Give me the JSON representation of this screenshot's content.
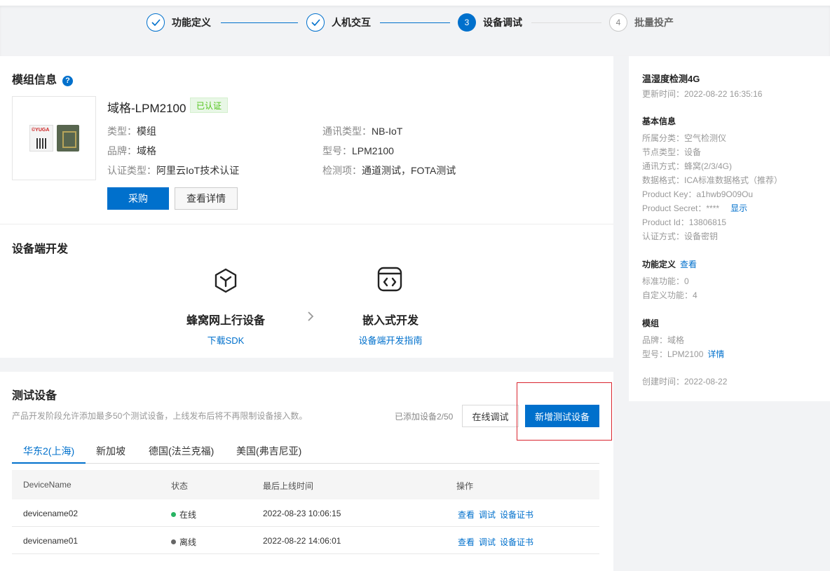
{
  "stepper": {
    "steps": [
      {
        "label": "功能定义",
        "state": "done",
        "icon": "check-icon"
      },
      {
        "label": "人机交互",
        "state": "done",
        "icon": "check-icon"
      },
      {
        "label": "设备调试",
        "state": "active",
        "number": "3"
      },
      {
        "label": "批量投产",
        "state": "todo",
        "number": "4"
      }
    ]
  },
  "module": {
    "title": "模组信息",
    "help_icon": "?",
    "name": "域格-LPM2100",
    "badge": "已认证",
    "image_logo_text": "©YUGA",
    "type_label": "类型：",
    "type_value": "模组",
    "brand_label": "品牌：",
    "brand_value": "域格",
    "cert_label": "认证类型：",
    "cert_value": "阿里云IoT技术认证",
    "comm_label": "通讯类型：",
    "comm_value": "NB-IoT",
    "model_label": "型号：",
    "model_value": "LPM2100",
    "check_label": "检测项：",
    "check_value": "通道测试，FOTA测试",
    "buy_button": "采购",
    "detail_button": "查看详情"
  },
  "device_dev": {
    "title": "设备端开发",
    "cards": [
      {
        "title": "蜂窝网上行设备",
        "link": "下载SDK",
        "icon": "cube-icon"
      },
      {
        "title": "嵌入式开发",
        "link": "设备端开发指南",
        "icon": "code-window-icon"
      }
    ],
    "arrow": "›"
  },
  "test_devices": {
    "title": "测试设备",
    "desc": "产品开发阶段允许添加最多50个测试设备，上线发布后将不再限制设备接入数。",
    "count_text": "已添加设备2/50",
    "online_debug_button": "在线调试",
    "add_button": "新增测试设备",
    "highlight_color": "#d9252f",
    "tabs": [
      "华东2(上海)",
      "新加坡",
      "德国(法兰克福)",
      "美国(弗吉尼亚)"
    ],
    "active_tab": 0,
    "columns": [
      "DeviceName",
      "状态",
      "最后上线时间",
      "操作"
    ],
    "rows": [
      {
        "name": "devicename02",
        "status": "在线",
        "status_color": "#28b463",
        "time": "2022-08-23 10:06:15",
        "ops": [
          "查看",
          "调试",
          "设备证书"
        ]
      },
      {
        "name": "devicename01",
        "status": "离线",
        "status_color": "#666666",
        "time": "2022-08-22 14:06:01",
        "ops": [
          "查看",
          "调试",
          "设备证书"
        ]
      }
    ]
  },
  "sidebar": {
    "product_name": "温湿度检测4G",
    "update_time": "更新时间：2022-08-22 16:35:16",
    "basic_title": "基本信息",
    "basic_lines": [
      "所属分类：空气检测仪",
      "节点类型：设备",
      "通讯方式：蜂窝(2/3/4G)",
      "数据格式：ICA标准数据格式（推荐）",
      "Product Key：a1hwb9O09Ou",
      "Product Secret：****",
      "Product Id：13806815",
      "认证方式：设备密钥"
    ],
    "show_link": "显示",
    "func_title": "功能定义",
    "func_link": "查看",
    "func_lines": [
      "标准功能：0",
      "自定义功能：4"
    ],
    "module_title": "模组",
    "module_lines": [
      "品牌：域格",
      "型号：LPM2100"
    ],
    "module_link": "详情",
    "created": "创建时间：2022-08-22"
  }
}
